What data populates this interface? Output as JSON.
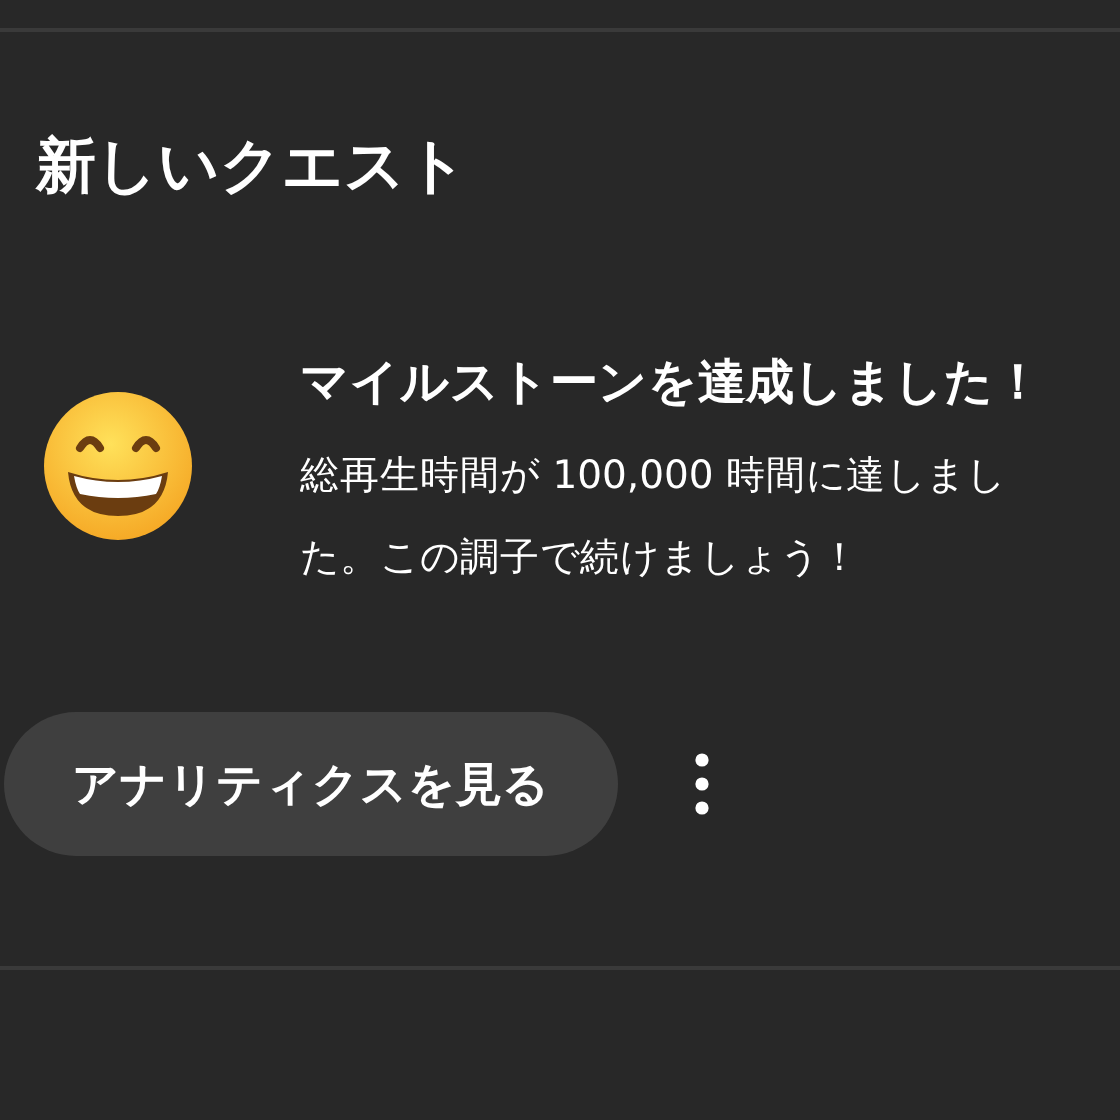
{
  "section": {
    "title": "新しいクエスト"
  },
  "quest": {
    "heading": "マイルストーンを達成しました！",
    "body": "総再生時間が 100,000 時間に達しました。この調子で続けましょう！"
  },
  "actions": {
    "primary": "アナリティクスを見る",
    "menu": true
  }
}
